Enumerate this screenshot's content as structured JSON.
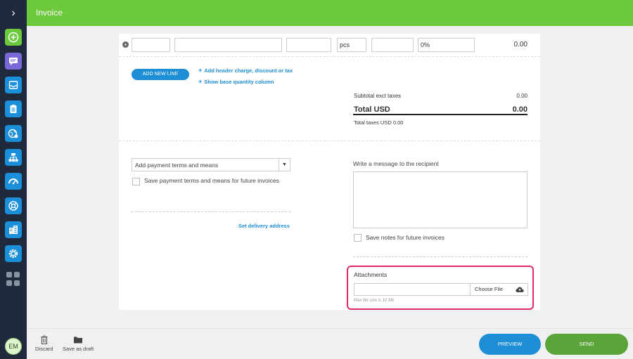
{
  "header": {
    "title": "Invoice"
  },
  "sidebar": {
    "toggle_glyph": "›",
    "avatar_initials": "EM",
    "icons": [
      "plus-icon",
      "chat-icon",
      "inbox-icon",
      "clipboard-icon",
      "globe-icon",
      "sitemap-icon",
      "dashboard-icon",
      "support-icon",
      "building-icon",
      "settings-icon",
      "apps-grid-icon"
    ]
  },
  "line_item": {
    "add_glyph": "+",
    "unit": "pcs",
    "tax": "0%",
    "total": "0.00"
  },
  "actions": {
    "add_new_line": "ADD NEW LINE",
    "add_header_charge": "Add header charge, discount or tax",
    "show_base_quantity": "Show base quantity column",
    "link_glyph": "+"
  },
  "totals": {
    "subtotal_label": "Subtotal excl taxes",
    "subtotal_value": "0.00",
    "total_label": "Total USD",
    "total_value": "0.00",
    "taxes_label": "Total taxes USD 0.00"
  },
  "payment": {
    "select_placeholder": "Add payment terms and means",
    "select_caret": "▼",
    "save_terms_label": "Save payment terms and means for future invoices",
    "delivery_link": "Set delivery address"
  },
  "message": {
    "label": "Write a message to the recipient",
    "save_notes_label": "Save notes for future invoices"
  },
  "attachments": {
    "label": "Attachments",
    "choose_file": "Choose File",
    "hint": "Max file size is 10 Mb"
  },
  "footer": {
    "discard": "Discard",
    "save_draft": "Save as draft",
    "preview": "PREVIEW",
    "send": "SEND"
  },
  "colors": {
    "header": "#6cc93b",
    "sidebar": "#1f2a3d",
    "link": "#1e8fd6",
    "send": "#5aa43a",
    "highlight": "#e0286e"
  }
}
